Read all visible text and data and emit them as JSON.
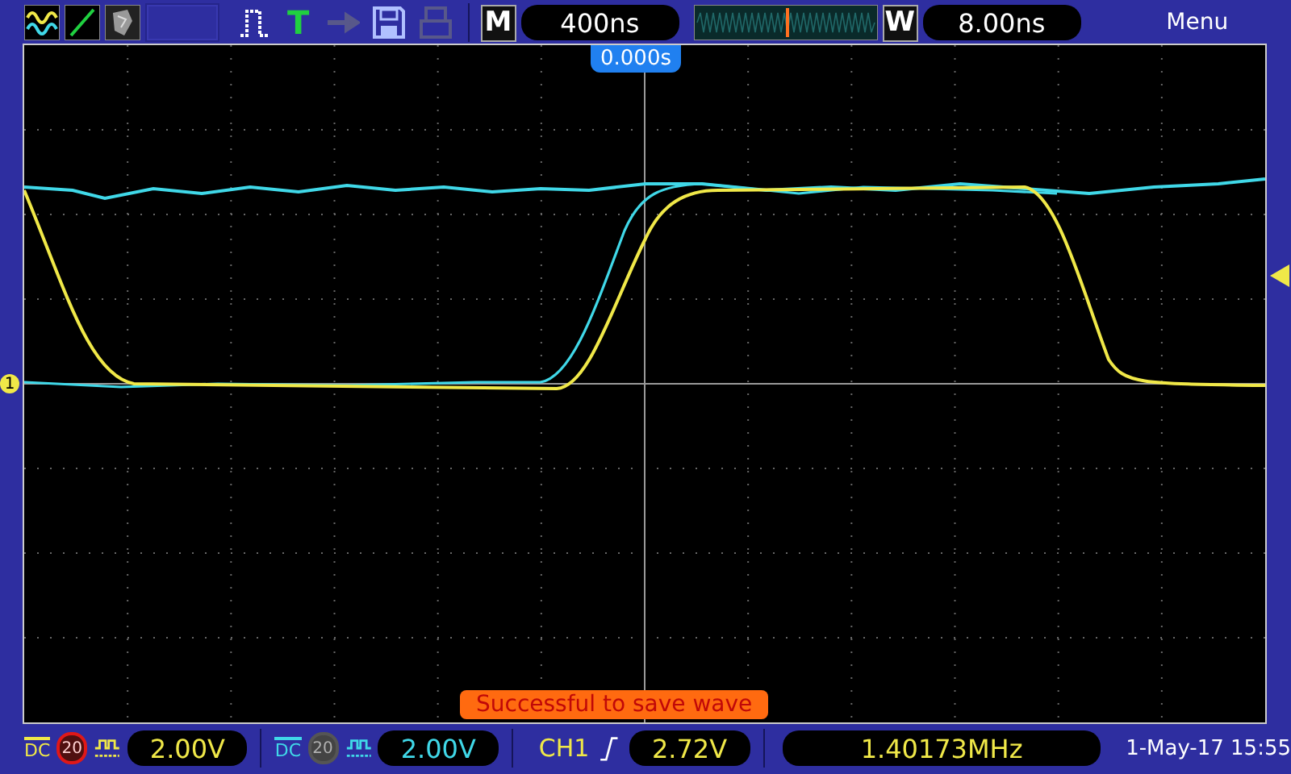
{
  "toolbar": {
    "trigger_label": "T",
    "memory_label": "M",
    "timebase": "400ns",
    "window_label": "W",
    "window_scale": "8.00ns",
    "menu": "Menu"
  },
  "trigger_position": "0.000s",
  "message": "Successful to save wave",
  "channels": [
    {
      "marker": "1",
      "coupling": "DC",
      "bw_label": "20",
      "bw_limit": true,
      "scale": "2.00V",
      "color": "#f0e848"
    },
    {
      "coupling": "DC",
      "bw_label": "20",
      "bw_limit": false,
      "scale": "2.00V",
      "color": "#40d8e8"
    }
  ],
  "trigger": {
    "source": "CH1",
    "level": "2.72V"
  },
  "frequency": "1.40173MHz",
  "datetime": "1-May-17 15:55"
}
